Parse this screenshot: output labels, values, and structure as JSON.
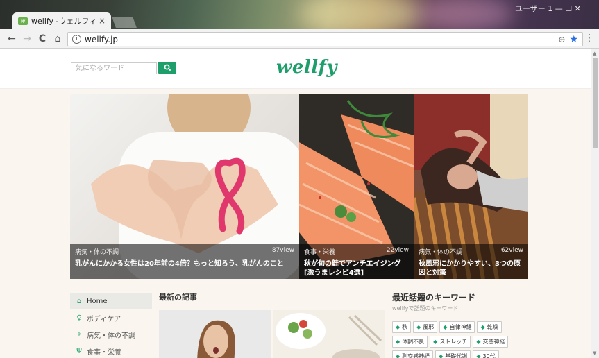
{
  "browser": {
    "tab_title": "wellfy -ウェルフィー | ヘルス",
    "tab_close": "×",
    "favicon_text": "w",
    "url": "wellfy.jp",
    "nav": {
      "back": "←",
      "forward": "→",
      "reload": "C",
      "home": "⌂"
    },
    "address_icon": "i",
    "zoom_icon": "⊕",
    "bookmark_icon": "★",
    "menu_icon": "⋮",
    "window_controls": "ユーザー 1  —  ☐  ✕"
  },
  "header": {
    "search_placeholder": "気になるワード",
    "logo": "wellfy"
  },
  "hero": [
    {
      "category": "病気・体の不調",
      "views": "87view",
      "title": "乳がんにかかる女性は20年前の4倍？もっと知ろう、乳がんのこと"
    },
    {
      "category": "食事・栄養",
      "views": "22view",
      "title": "秋が旬の鮭でアンチエイジング[激うまレシピ4選]"
    },
    {
      "category": "病気・体の不調",
      "views": "62view",
      "title": "秋風邪にかかりやすい、3つの原因と対策"
    }
  ],
  "sidebar": {
    "items": [
      {
        "label": "Home",
        "icon": "home-icon"
      },
      {
        "label": "ボディケア",
        "icon": "figure-icon"
      },
      {
        "label": "病気・体の不調",
        "icon": "pill-icon"
      },
      {
        "label": "食事・栄養",
        "icon": "fork-knife-icon"
      }
    ]
  },
  "main": {
    "title": "最新の記事"
  },
  "keywords": {
    "title": "最近話題のキーワード",
    "subtitle": "wellfyで話題のキーワード",
    "tags": [
      "秋",
      "風邪",
      "自律神経",
      "乾燥",
      "体調不良",
      "ストレッチ",
      "交感神経",
      "副交感神経",
      "基礎代謝",
      "30代"
    ]
  },
  "colors": {
    "brand": "#1e9e6a",
    "caption_overlay": "rgba(0,0,0,0.55)"
  }
}
